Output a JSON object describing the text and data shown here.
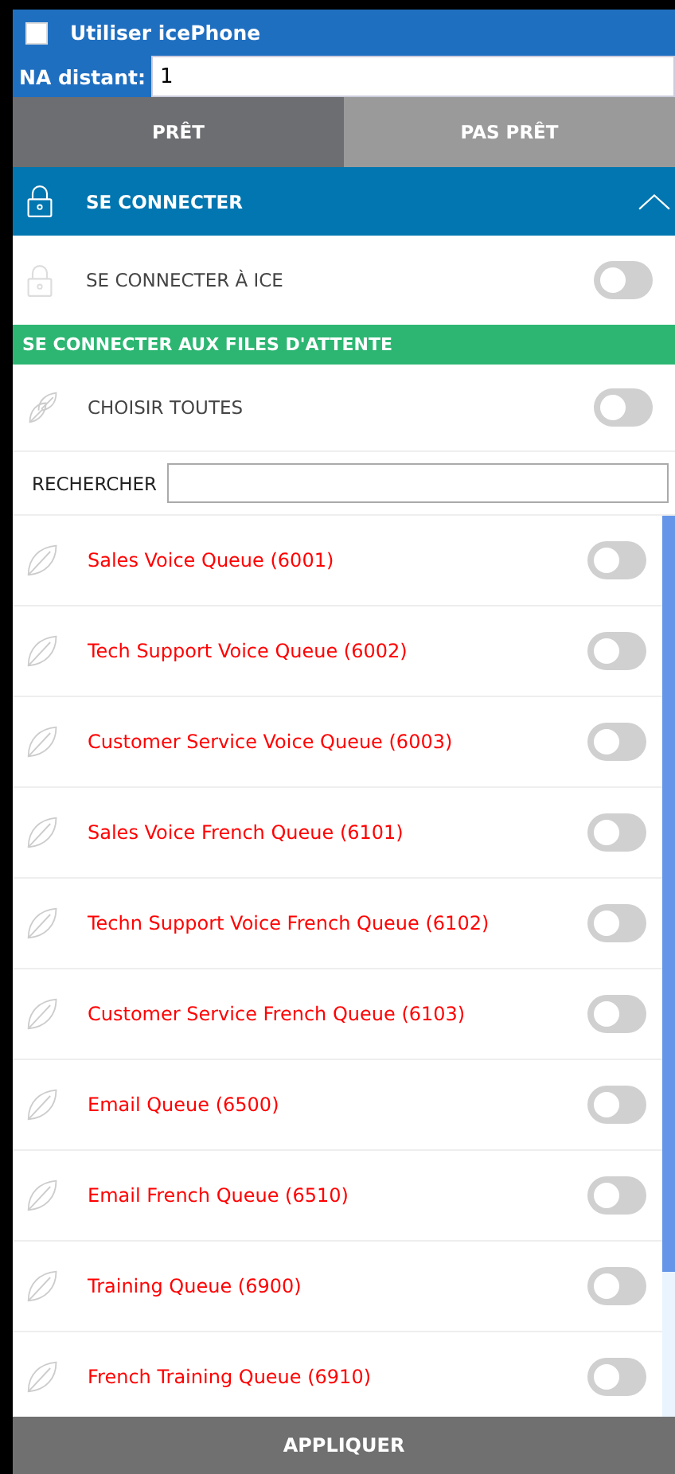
{
  "use_icephone": {
    "label": "Utiliser icePhone",
    "checked": false
  },
  "remote_na": {
    "label": "NA distant:",
    "value": "1"
  },
  "tabs": [
    {
      "label": "PRÊT",
      "selected": true
    },
    {
      "label": "PAS PRÊT",
      "selected": false
    }
  ],
  "connect_section": {
    "title": "SE CONNECTER",
    "expanded": true
  },
  "connect_ice": {
    "label": "SE CONNECTER À ICE",
    "on": false
  },
  "queues_header": "SE CONNECTER AUX FILES D'ATTENTE",
  "select_all": {
    "label": "CHOISIR TOUTES",
    "on": false
  },
  "search": {
    "label": "RECHERCHER"
  },
  "queues": [
    {
      "name": "Sales Voice Queue (6001)",
      "on": false
    },
    {
      "name": "Tech Support Voice Queue (6002)",
      "on": false
    },
    {
      "name": "Customer Service Voice Queue (6003)",
      "on": false
    },
    {
      "name": "Sales Voice French Queue (6101)",
      "on": false
    },
    {
      "name": "Techn Support Voice French Queue (6102)",
      "on": false
    },
    {
      "name": "Customer Service French Queue (6103)",
      "on": false
    },
    {
      "name": "Email Queue (6500)",
      "on": false
    },
    {
      "name": "Email French Queue (6510)",
      "on": false
    },
    {
      "name": "Training Queue (6900)",
      "on": false
    },
    {
      "name": "French Training Queue (6910)",
      "on": false
    }
  ],
  "apply_button": "APPLIQUER"
}
